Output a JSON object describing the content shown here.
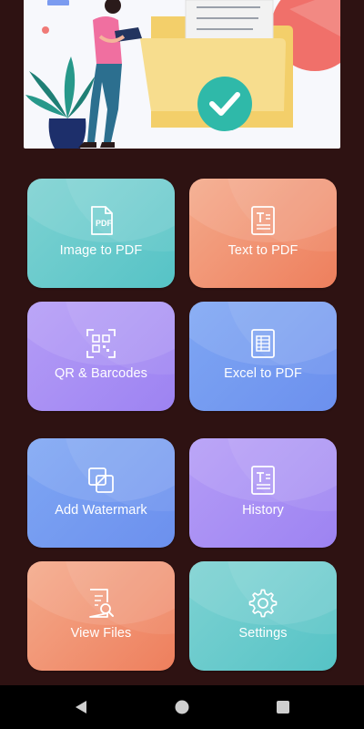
{
  "tiles": [
    {
      "label": "Image to PDF",
      "icon": "image-pdf-icon",
      "color": "#5fc7c9"
    },
    {
      "label": "Text to PDF",
      "icon": "text-document-icon",
      "color": "#f08a68"
    },
    {
      "label": "QR & Barcodes",
      "icon": "qr-scan-icon",
      "color": "#a68af4"
    },
    {
      "label": "Excel to PDF",
      "icon": "spreadsheet-icon",
      "color": "#739af0"
    },
    {
      "label": "Add Watermark",
      "icon": "watermark-icon",
      "color": "#739af0"
    },
    {
      "label": "History",
      "icon": "text-document-icon",
      "color": "#a68af4"
    },
    {
      "label": "View Files",
      "icon": "file-search-icon",
      "color": "#f08a68"
    },
    {
      "label": "Settings",
      "icon": "gear-icon",
      "color": "#5fc7c9"
    }
  ],
  "pdf_badge": "PDF",
  "navigation": {
    "back": "back-triangle-icon",
    "home": "home-circle-icon",
    "recents": "recents-square-icon"
  }
}
